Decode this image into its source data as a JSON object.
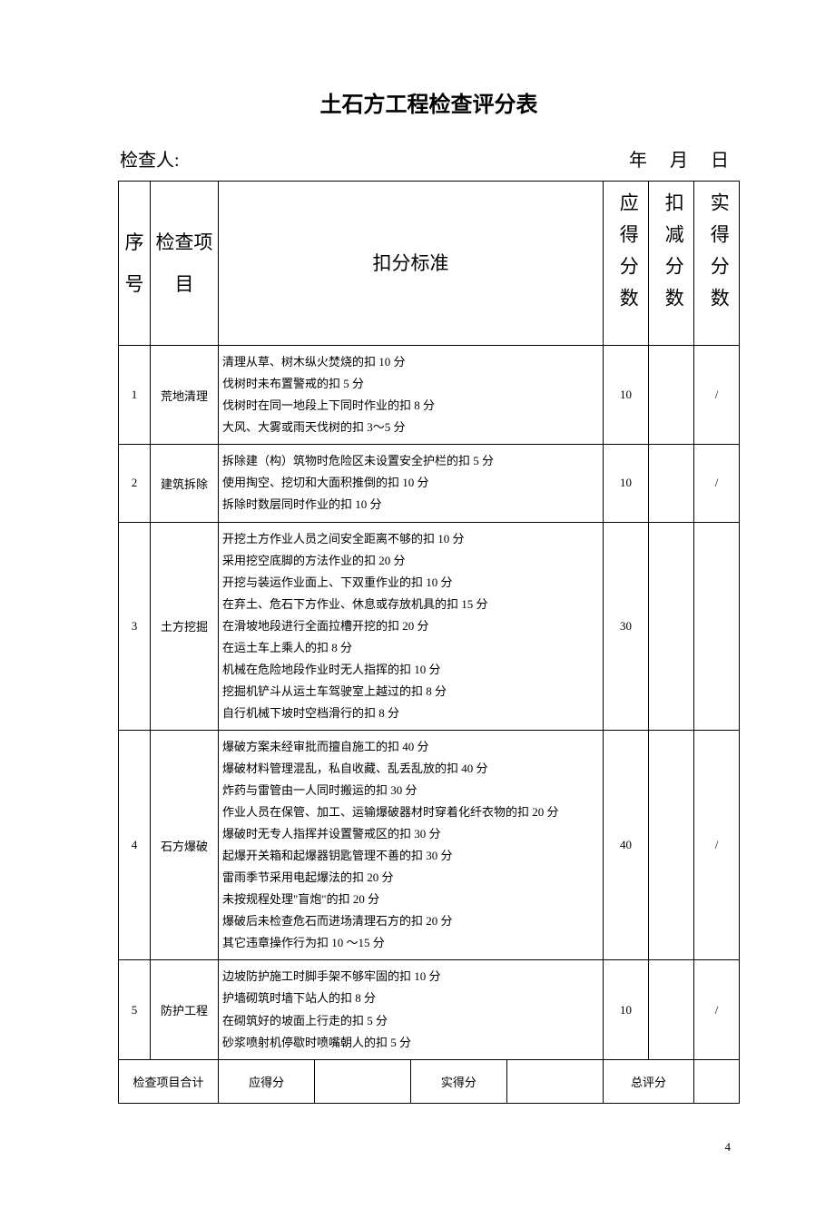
{
  "title": "土石方工程检查评分表",
  "meta": {
    "inspector_label": "检查人:",
    "date_label": "年 月 日"
  },
  "headers": {
    "idx": "序号",
    "item": "检查项目",
    "criteria": "扣分标准",
    "due": "应得分数",
    "deduct": "扣减分数",
    "actual": "实得分数"
  },
  "rows": [
    {
      "idx": "1",
      "item": "荒地清理",
      "criteria": [
        "清理从草、树木纵火焚烧的扣 10 分",
        "伐树时未布置警戒的扣 5 分",
        "伐树时在同一地段上下同时作业的扣 8 分",
        "大风、大雾或雨天伐树的扣 3～5 分"
      ],
      "due": "10",
      "deduct": "",
      "actual": "/"
    },
    {
      "idx": "2",
      "item": "建筑拆除",
      "criteria": [
        "拆除建（构）筑物时危险区未设置安全护栏的扣 5 分",
        "使用掏空、挖切和大面积推倒的扣 10 分",
        "拆除时数层同时作业的扣 10 分"
      ],
      "due": "10",
      "deduct": "",
      "actual": "/"
    },
    {
      "idx": "3",
      "item": "土方挖掘",
      "criteria": [
        "开挖土方作业人员之间安全距离不够的扣 10 分",
        "采用挖空底脚的方法作业的扣 20 分",
        "开挖与装运作业面上、下双重作业的扣 10 分",
        "在弃土、危石下方作业、休息或存放机具的扣 15 分",
        "在滑坡地段进行全面拉槽开挖的扣 20 分",
        "在运土车上乘人的扣 8 分",
        "机械在危险地段作业时无人指挥的扣 10 分",
        "挖掘机铲斗从运土车驾驶室上越过的扣 8 分",
        "自行机械下坡时空档滑行的扣 8 分"
      ],
      "due": "30",
      "deduct": "",
      "actual": ""
    },
    {
      "idx": "4",
      "item": "石方爆破",
      "criteria": [
        "爆破方案未经审批而擅自施工的扣 40 分",
        "爆破材料管理混乱，私自收藏、乱丢乱放的扣 40 分",
        "炸药与雷管由一人同时搬运的扣 30 分",
        "作业人员在保管、加工、运输爆破器材时穿着化纤衣物的扣 20 分",
        "爆破时无专人指挥并设置警戒区的扣 30 分",
        "起爆开关箱和起爆器钥匙管理不善的扣 30 分",
        "雷雨季节采用电起爆法的扣 20 分",
        "未按规程处理\"盲炮\"的扣 20 分",
        "爆破后未检查危石而进场清理石方的扣 20 分",
        "其它违章操作行为扣 10 ～15 分"
      ],
      "due": "40",
      "deduct": "",
      "actual": "/"
    },
    {
      "idx": "5",
      "item": "防护工程",
      "criteria": [
        "边坡防护施工时脚手架不够牢固的扣 10 分",
        "护墙砌筑时墙下站人的扣 8 分",
        "在砌筑好的坡面上行走的扣 5 分",
        "砂浆喷射机停歇时喷嘴朝人的扣 5 分"
      ],
      "due": "10",
      "deduct": "",
      "actual": "/"
    }
  ],
  "footer": {
    "total_label": "检查项目合计",
    "due_label": "应得分",
    "due_value": "",
    "actual_label": "实得分",
    "actual_value": "",
    "overall_label": "总评分",
    "overall_value": ""
  },
  "page_number": "4"
}
